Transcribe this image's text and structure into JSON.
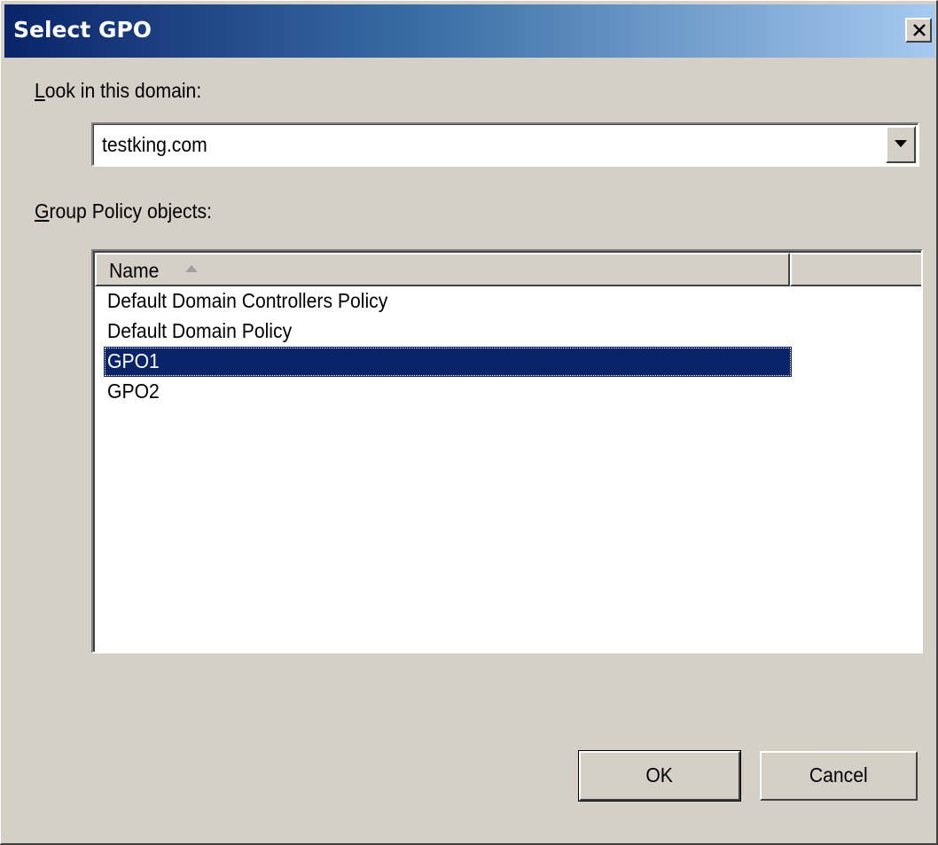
{
  "window": {
    "title": "Select GPO",
    "close_icon": "close-x-icon"
  },
  "domain": {
    "label_underlined": "L",
    "label_rest": "ook in this domain:",
    "selected_value": "testking.com",
    "dropdown_icon": "chevron-down-icon"
  },
  "gpo_list": {
    "label_underlined": "G",
    "label_rest": "roup Policy objects:",
    "columns": [
      {
        "label": "Name",
        "sorted": "ascending"
      },
      {
        "label": ""
      }
    ],
    "rows": [
      {
        "name": "Default Domain Controllers Policy",
        "selected": false
      },
      {
        "name": "Default Domain Policy",
        "selected": false
      },
      {
        "name": "GPO1",
        "selected": true
      },
      {
        "name": "GPO2",
        "selected": false
      }
    ]
  },
  "buttons": {
    "ok_label": "OK",
    "cancel_label": "Cancel"
  },
  "colors": {
    "titlebar_start": "#0a246a",
    "titlebar_end": "#a6caf0",
    "selection": "#0a246a",
    "face": "#d4d0c8"
  }
}
